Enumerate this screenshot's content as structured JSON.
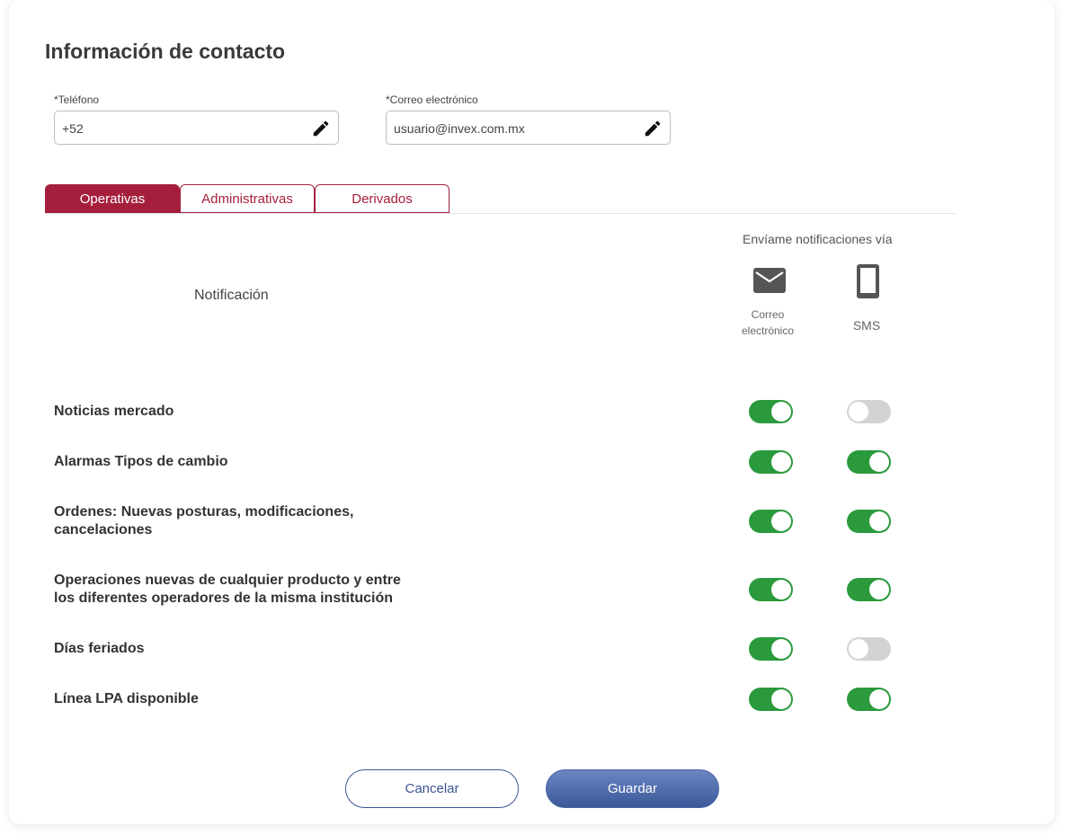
{
  "page": {
    "title": "Información de contacto"
  },
  "phone": {
    "label": "*Teléfono",
    "value": "+52"
  },
  "email": {
    "label": "*Correo electrónico",
    "value": "usuario@invex.com.mx"
  },
  "tabs": [
    {
      "label": "Operativas",
      "active": true
    },
    {
      "label": "Administrativas",
      "active": false
    },
    {
      "label": "Derivados",
      "active": false
    }
  ],
  "table": {
    "via_header": "Envíame notificaciones vía",
    "notification_header": "Notificación",
    "channels": {
      "email_label_line1": "Correo",
      "email_label_line2": "electrónico",
      "email_icon": "mail-icon",
      "sms_label": "SMS",
      "sms_icon": "phone-icon"
    },
    "rows": [
      {
        "line1": "Noticias mercado",
        "line2": "",
        "email_on": true,
        "sms_on": false
      },
      {
        "line1": "Alarmas Tipos de cambio",
        "line2": "",
        "email_on": true,
        "sms_on": true
      },
      {
        "line1": "Ordenes: Nuevas posturas, modificaciones,",
        "line2": "cancelaciones",
        "email_on": true,
        "sms_on": true
      },
      {
        "line1": "Operaciones nuevas de cualquier producto y entre",
        "line2": "los diferentes operadores de la misma institución",
        "email_on": true,
        "sms_on": true
      },
      {
        "line1": "Días feriados",
        "line2": "",
        "email_on": true,
        "sms_on": false
      },
      {
        "line1": "Línea LPA disponible",
        "line2": "",
        "email_on": true,
        "sms_on": true
      }
    ]
  },
  "actions": {
    "cancel_label": "Cancelar",
    "save_label": "Guardar"
  },
  "colors": {
    "accent": "#a51f3d",
    "toggle_on": "#2a9a3c",
    "toggle_off": "#d3d3d3",
    "button_primary": "#4a65a3"
  }
}
